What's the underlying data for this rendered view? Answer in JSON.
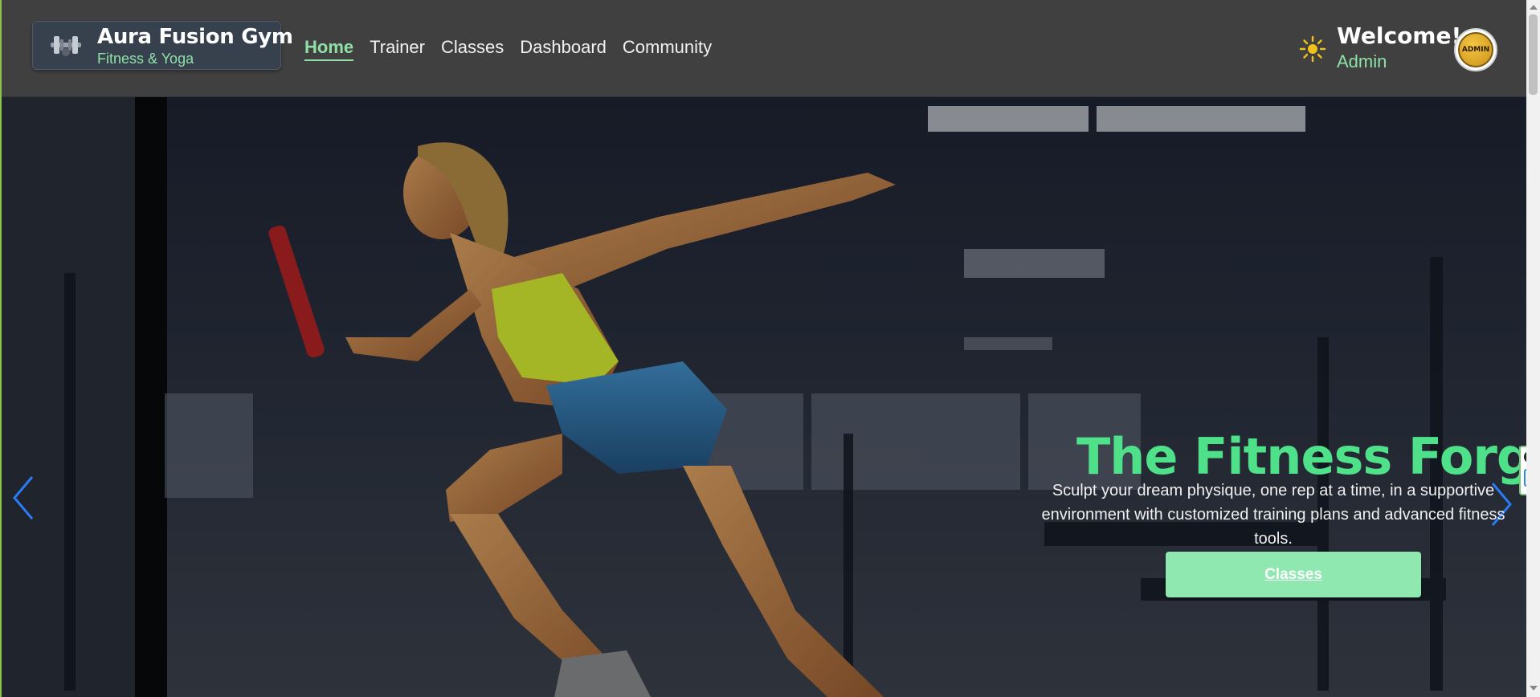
{
  "brand": {
    "name": "Aura Fusion Gym",
    "tagline": "Fitness & Yoga",
    "logo_icon": "dumbbell-icon"
  },
  "nav": {
    "items": [
      {
        "label": "Home",
        "active": true
      },
      {
        "label": "Trainer",
        "active": false
      },
      {
        "label": "Classes",
        "active": false
      },
      {
        "label": "Dashboard",
        "active": false
      },
      {
        "label": "Community",
        "active": false
      }
    ]
  },
  "user": {
    "welcome": "Welcome!",
    "name": "Admin",
    "avatar_text": "ADMIN",
    "theme_icon": "sun-icon"
  },
  "hero": {
    "title": "The Fitness Forge",
    "description_lines": [
      "Sculpt your dream physique, one rep at a time, in a supportive",
      "environment with customized training plans and advanced fitness",
      "tools."
    ],
    "cta_label": "Classes",
    "prev_icon": "chevron-left-icon",
    "next_icon": "chevron-right-icon"
  },
  "colors": {
    "accent": "#8ee0a6",
    "title_green": "#4fe08a",
    "navbar_bg": "#404040",
    "button_bg": "#8ee8b0"
  }
}
